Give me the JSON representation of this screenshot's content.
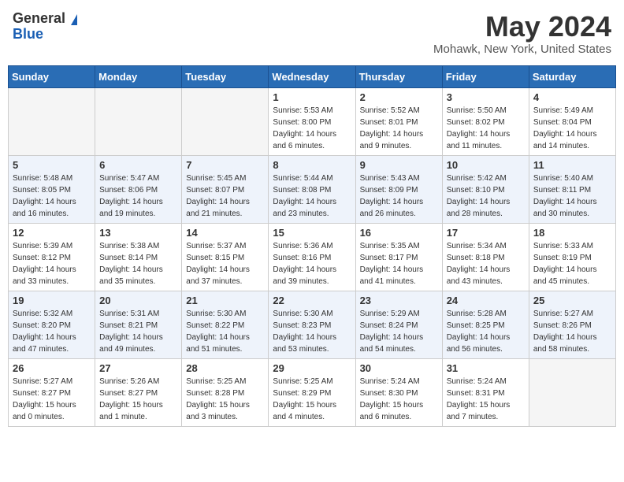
{
  "header": {
    "logo_general": "General",
    "logo_blue": "Blue",
    "month_title": "May 2024",
    "location": "Mohawk, New York, United States"
  },
  "days_of_week": [
    "Sunday",
    "Monday",
    "Tuesday",
    "Wednesday",
    "Thursday",
    "Friday",
    "Saturday"
  ],
  "weeks": [
    [
      {
        "day": "",
        "empty": true
      },
      {
        "day": "",
        "empty": true
      },
      {
        "day": "",
        "empty": true
      },
      {
        "day": "1",
        "sunrise": "Sunrise: 5:53 AM",
        "sunset": "Sunset: 8:00 PM",
        "daylight": "Daylight: 14 hours and 6 minutes."
      },
      {
        "day": "2",
        "sunrise": "Sunrise: 5:52 AM",
        "sunset": "Sunset: 8:01 PM",
        "daylight": "Daylight: 14 hours and 9 minutes."
      },
      {
        "day": "3",
        "sunrise": "Sunrise: 5:50 AM",
        "sunset": "Sunset: 8:02 PM",
        "daylight": "Daylight: 14 hours and 11 minutes."
      },
      {
        "day": "4",
        "sunrise": "Sunrise: 5:49 AM",
        "sunset": "Sunset: 8:04 PM",
        "daylight": "Daylight: 14 hours and 14 minutes."
      }
    ],
    [
      {
        "day": "5",
        "sunrise": "Sunrise: 5:48 AM",
        "sunset": "Sunset: 8:05 PM",
        "daylight": "Daylight: 14 hours and 16 minutes."
      },
      {
        "day": "6",
        "sunrise": "Sunrise: 5:47 AM",
        "sunset": "Sunset: 8:06 PM",
        "daylight": "Daylight: 14 hours and 19 minutes."
      },
      {
        "day": "7",
        "sunrise": "Sunrise: 5:45 AM",
        "sunset": "Sunset: 8:07 PM",
        "daylight": "Daylight: 14 hours and 21 minutes."
      },
      {
        "day": "8",
        "sunrise": "Sunrise: 5:44 AM",
        "sunset": "Sunset: 8:08 PM",
        "daylight": "Daylight: 14 hours and 23 minutes."
      },
      {
        "day": "9",
        "sunrise": "Sunrise: 5:43 AM",
        "sunset": "Sunset: 8:09 PM",
        "daylight": "Daylight: 14 hours and 26 minutes."
      },
      {
        "day": "10",
        "sunrise": "Sunrise: 5:42 AM",
        "sunset": "Sunset: 8:10 PM",
        "daylight": "Daylight: 14 hours and 28 minutes."
      },
      {
        "day": "11",
        "sunrise": "Sunrise: 5:40 AM",
        "sunset": "Sunset: 8:11 PM",
        "daylight": "Daylight: 14 hours and 30 minutes."
      }
    ],
    [
      {
        "day": "12",
        "sunrise": "Sunrise: 5:39 AM",
        "sunset": "Sunset: 8:12 PM",
        "daylight": "Daylight: 14 hours and 33 minutes."
      },
      {
        "day": "13",
        "sunrise": "Sunrise: 5:38 AM",
        "sunset": "Sunset: 8:14 PM",
        "daylight": "Daylight: 14 hours and 35 minutes."
      },
      {
        "day": "14",
        "sunrise": "Sunrise: 5:37 AM",
        "sunset": "Sunset: 8:15 PM",
        "daylight": "Daylight: 14 hours and 37 minutes."
      },
      {
        "day": "15",
        "sunrise": "Sunrise: 5:36 AM",
        "sunset": "Sunset: 8:16 PM",
        "daylight": "Daylight: 14 hours and 39 minutes."
      },
      {
        "day": "16",
        "sunrise": "Sunrise: 5:35 AM",
        "sunset": "Sunset: 8:17 PM",
        "daylight": "Daylight: 14 hours and 41 minutes."
      },
      {
        "day": "17",
        "sunrise": "Sunrise: 5:34 AM",
        "sunset": "Sunset: 8:18 PM",
        "daylight": "Daylight: 14 hours and 43 minutes."
      },
      {
        "day": "18",
        "sunrise": "Sunrise: 5:33 AM",
        "sunset": "Sunset: 8:19 PM",
        "daylight": "Daylight: 14 hours and 45 minutes."
      }
    ],
    [
      {
        "day": "19",
        "sunrise": "Sunrise: 5:32 AM",
        "sunset": "Sunset: 8:20 PM",
        "daylight": "Daylight: 14 hours and 47 minutes."
      },
      {
        "day": "20",
        "sunrise": "Sunrise: 5:31 AM",
        "sunset": "Sunset: 8:21 PM",
        "daylight": "Daylight: 14 hours and 49 minutes."
      },
      {
        "day": "21",
        "sunrise": "Sunrise: 5:30 AM",
        "sunset": "Sunset: 8:22 PM",
        "daylight": "Daylight: 14 hours and 51 minutes."
      },
      {
        "day": "22",
        "sunrise": "Sunrise: 5:30 AM",
        "sunset": "Sunset: 8:23 PM",
        "daylight": "Daylight: 14 hours and 53 minutes."
      },
      {
        "day": "23",
        "sunrise": "Sunrise: 5:29 AM",
        "sunset": "Sunset: 8:24 PM",
        "daylight": "Daylight: 14 hours and 54 minutes."
      },
      {
        "day": "24",
        "sunrise": "Sunrise: 5:28 AM",
        "sunset": "Sunset: 8:25 PM",
        "daylight": "Daylight: 14 hours and 56 minutes."
      },
      {
        "day": "25",
        "sunrise": "Sunrise: 5:27 AM",
        "sunset": "Sunset: 8:26 PM",
        "daylight": "Daylight: 14 hours and 58 minutes."
      }
    ],
    [
      {
        "day": "26",
        "sunrise": "Sunrise: 5:27 AM",
        "sunset": "Sunset: 8:27 PM",
        "daylight": "Daylight: 15 hours and 0 minutes."
      },
      {
        "day": "27",
        "sunrise": "Sunrise: 5:26 AM",
        "sunset": "Sunset: 8:27 PM",
        "daylight": "Daylight: 15 hours and 1 minute."
      },
      {
        "day": "28",
        "sunrise": "Sunrise: 5:25 AM",
        "sunset": "Sunset: 8:28 PM",
        "daylight": "Daylight: 15 hours and 3 minutes."
      },
      {
        "day": "29",
        "sunrise": "Sunrise: 5:25 AM",
        "sunset": "Sunset: 8:29 PM",
        "daylight": "Daylight: 15 hours and 4 minutes."
      },
      {
        "day": "30",
        "sunrise": "Sunrise: 5:24 AM",
        "sunset": "Sunset: 8:30 PM",
        "daylight": "Daylight: 15 hours and 6 minutes."
      },
      {
        "day": "31",
        "sunrise": "Sunrise: 5:24 AM",
        "sunset": "Sunset: 8:31 PM",
        "daylight": "Daylight: 15 hours and 7 minutes."
      },
      {
        "day": "",
        "empty": true
      }
    ]
  ]
}
